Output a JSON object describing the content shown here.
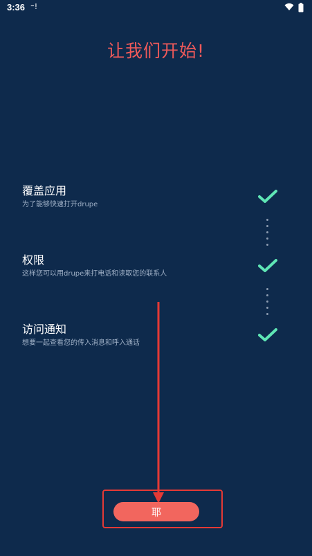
{
  "status_bar": {
    "time": "3:36",
    "notification_icon": "⁼!",
    "wifi_icon": "wifi-icon",
    "battery_icon": "battery-icon"
  },
  "onboarding": {
    "title": "让我们开始!",
    "steps": [
      {
        "title": "覆盖应用",
        "description": "为了能够快速打开drupe"
      },
      {
        "title": "权限",
        "description": "这样您可以用drupe来打电话和读取您的联系人"
      },
      {
        "title": "访问通知",
        "description": "想要一起查看您的传入消息和呼入通话"
      }
    ],
    "button_label": "耶"
  },
  "colors": {
    "background": "#0e2a4c",
    "accent": "#f05a5a",
    "check": "#5fe6b5",
    "highlight": "#e53935"
  }
}
